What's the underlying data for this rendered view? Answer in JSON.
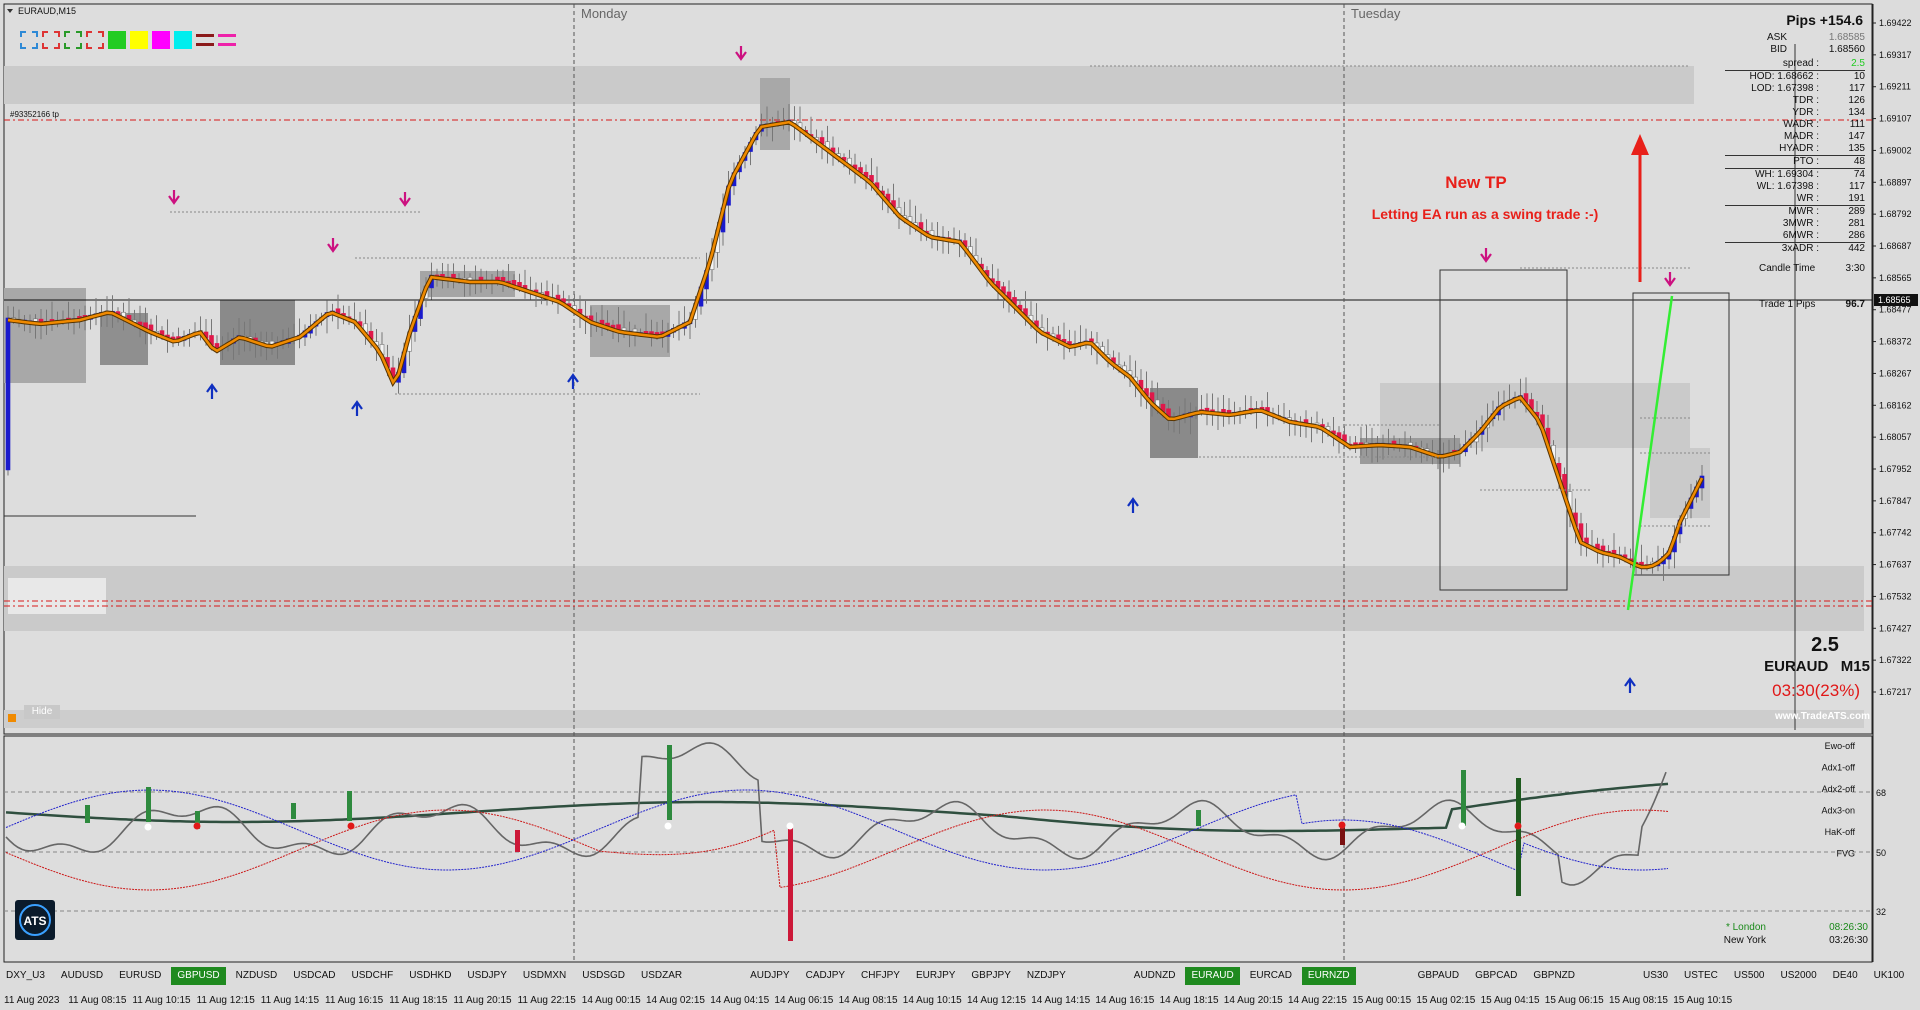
{
  "window": {
    "title": "EURAUD,M15",
    "order_label": "#93352166 tp"
  },
  "colors": {
    "bull": "#1a1acc",
    "bear": "#e0184a",
    "ma": "#f08a00",
    "sell_arrow": "#cc1180",
    "buy_arrow": "#1030c0",
    "trend": "#33ee33",
    "annotation": "#e8201a",
    "active_symbol": "#1f8a1f"
  },
  "toolbar": {
    "icons": [
      "rect-blue-icon",
      "rect-red-outline-icon",
      "rect-green-outline-icon",
      "rect-red-outline-icon",
      "green-square-icon",
      "yellow-square-icon",
      "magenta-square-icon",
      "cyan-square-icon",
      "hline-icon",
      "magenta-lines-icon"
    ],
    "colors": [
      "#2e8ad6",
      "#d33",
      "#2a9a2a",
      "#d33",
      "#22cc22",
      "#ffff00",
      "#ff00ff",
      "#00eeee",
      "#8b1a1a",
      "#ee22aa"
    ]
  },
  "sessions": {
    "monday": "Monday",
    "tuesday": "Tuesday"
  },
  "annotation": {
    "title": "New TP",
    "subtitle": "Letting EA run as a swing trade :-)"
  },
  "price_axis": {
    "labels": [
      "1.69422",
      "1.69317",
      "1.69211",
      "1.69107",
      "1.69002",
      "1.68897",
      "1.68792",
      "1.68687",
      "1.68565",
      "1.68477",
      "1.68372",
      "1.68267",
      "1.68162",
      "1.68057",
      "1.67952",
      "1.67847",
      "1.67742",
      "1.67637",
      "1.67532",
      "1.67427",
      "1.67322",
      "1.67217"
    ],
    "current_price": "1.68565"
  },
  "info_panel": {
    "pips_title": "Pips +154.6",
    "ask_label": "ASK",
    "ask_value": "1.68585",
    "bid_label": "BID",
    "bid_value": "1.68560",
    "rows": [
      {
        "k": "spread :",
        "v": "2.5"
      },
      {
        "k": "HOD: 1.68662 :",
        "v": "10"
      },
      {
        "k": "LOD: 1.67398 :",
        "v": "117"
      },
      {
        "k": "TDR :",
        "v": "126"
      },
      {
        "k": "YDR :",
        "v": "134"
      },
      {
        "k": "WADR :",
        "v": "111"
      },
      {
        "k": "MADR :",
        "v": "147"
      },
      {
        "k": "HYADR :",
        "v": "135"
      },
      {
        "k": "PTO :",
        "v": "48"
      },
      {
        "k": "WH: 1.69304 :",
        "v": "74"
      },
      {
        "k": "WL: 1.67398 :",
        "v": "117"
      },
      {
        "k": "WR :",
        "v": "191"
      },
      {
        "k": "MWR :",
        "v": "289"
      },
      {
        "k": "3MWR :",
        "v": "281"
      },
      {
        "k": "6MWR :",
        "v": "286"
      },
      {
        "k": "3xADR :",
        "v": "442"
      }
    ],
    "candle_time_label": "Candle Time",
    "candle_time_value": "3:30",
    "trade_label": "Trade 1 Pips",
    "trade_value": "96.7",
    "big_value": "2.5",
    "symbol_tf": "EURAUD   M15",
    "countdown": "03:30(23%)",
    "watermark": "www.TradeATS.com"
  },
  "indicator_labels": [
    "Ewo-off",
    "Adx1-off",
    "Adx2-off",
    "Adx3-on",
    "HaK-off",
    "FVG"
  ],
  "indicator_levels": [
    "68",
    "50",
    "32"
  ],
  "sessions_panel": [
    {
      "name": "* London",
      "time": "08:26:30"
    },
    {
      "name": "New York",
      "time": "03:26:30"
    }
  ],
  "hide_label": "Hide",
  "symbols": [
    {
      "name": "DXY_U3"
    },
    {
      "name": "AUDUSD"
    },
    {
      "name": "EURUSD"
    },
    {
      "name": "GBPUSD",
      "active": true
    },
    {
      "name": "NZDUSD"
    },
    {
      "name": "USDCAD"
    },
    {
      "name": "USDCHF"
    },
    {
      "name": "USDHKD"
    },
    {
      "name": "USDJPY"
    },
    {
      "name": "USDMXN"
    },
    {
      "name": "USDSGD"
    },
    {
      "name": "USDZAR"
    },
    {
      "name": "AUDJPY",
      "gap": true
    },
    {
      "name": "CADJPY"
    },
    {
      "name": "CHFJPY"
    },
    {
      "name": "EURJPY"
    },
    {
      "name": "GBPJPY"
    },
    {
      "name": "NZDJPY"
    },
    {
      "name": "AUDNZD",
      "gap": true
    },
    {
      "name": "EURAUD",
      "active": true
    },
    {
      "name": "EURCAD"
    },
    {
      "name": "EURNZD",
      "active": true
    },
    {
      "name": "GBPAUD",
      "gap": true
    },
    {
      "name": "GBPCAD"
    },
    {
      "name": "GBPNZD"
    },
    {
      "name": "US30",
      "gap": true
    },
    {
      "name": "USTEC"
    },
    {
      "name": "US500"
    },
    {
      "name": "US2000"
    },
    {
      "name": "DE40"
    },
    {
      "name": "UK100"
    }
  ],
  "time_labels": [
    "11 Aug 2023",
    "11 Aug 08:15",
    "11 Aug 10:15",
    "11 Aug 12:15",
    "11 Aug 14:15",
    "11 Aug 16:15",
    "11 Aug 18:15",
    "11 Aug 20:15",
    "11 Aug 22:15",
    "14 Aug 00:15",
    "14 Aug 02:15",
    "14 Aug 04:15",
    "14 Aug 06:15",
    "14 Aug 08:15",
    "14 Aug 10:15",
    "14 Aug 12:15",
    "14 Aug 14:15",
    "14 Aug 16:15",
    "14 Aug 18:15",
    "14 Aug 20:15",
    "14 Aug 22:15",
    "15 Aug 00:15",
    "15 Aug 02:15",
    "15 Aug 04:15",
    "15 Aug 06:15",
    "15 Aug 08:15",
    "15 Aug 10:15"
  ],
  "chart_data": {
    "type": "candlestick",
    "symbol": "EURAUD",
    "timeframe": "M15",
    "ylim": [
      1.67217,
      1.69422
    ],
    "x": [
      "11 Aug 2023",
      "11 Aug 08:15",
      "11 Aug 10:15",
      "11 Aug 12:15",
      "11 Aug 14:15",
      "11 Aug 16:15",
      "11 Aug 18:15",
      "11 Aug 20:15",
      "11 Aug 22:15",
      "14 Aug 00:15",
      "14 Aug 02:15",
      "14 Aug 04:15",
      "14 Aug 06:15",
      "14 Aug 08:15",
      "14 Aug 10:15",
      "14 Aug 12:15",
      "14 Aug 14:15",
      "14 Aug 16:15",
      "14 Aug 18:15",
      "14 Aug 20:15",
      "14 Aug 22:15",
      "15 Aug 00:15",
      "15 Aug 02:15",
      "15 Aug 04:15",
      "15 Aug 06:15",
      "15 Aug 08:15",
      "15 Aug 10:15"
    ],
    "close": [
      1.684,
      1.6842,
      1.6848,
      1.6838,
      1.6845,
      1.6843,
      1.6835,
      1.6858,
      1.685,
      1.6845,
      1.6843,
      1.687,
      1.6915,
      1.6895,
      1.6872,
      1.6858,
      1.684,
      1.683,
      1.682,
      1.6822,
      1.6812,
      1.6808,
      1.6812,
      1.6822,
      1.678,
      1.6773,
      1.68
    ],
    "current_price": 1.68565
  }
}
